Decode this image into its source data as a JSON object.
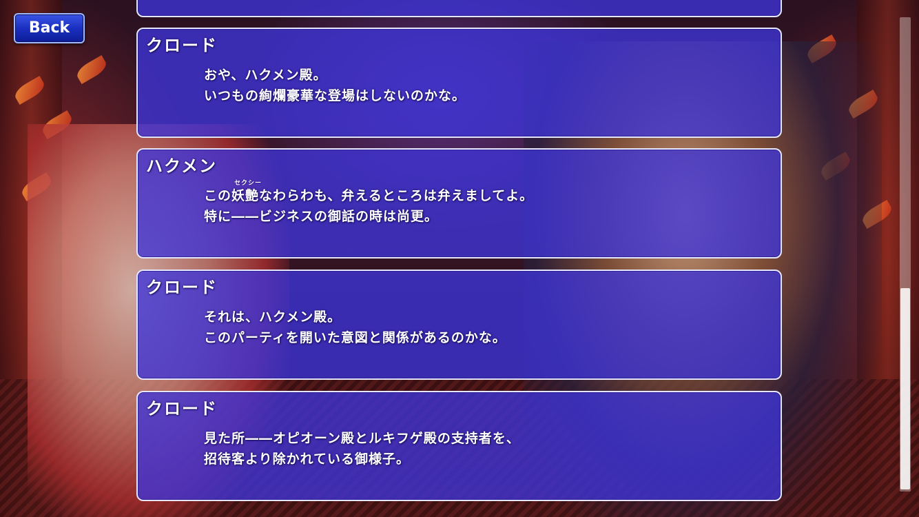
{
  "back_button": {
    "label": "Back"
  },
  "colors": {
    "panel_fill": "#3e34da",
    "panel_border": "#e6e6ff",
    "back_button": "#1a2fc0",
    "text": "#ffffff"
  },
  "scrollbar": {
    "position_fraction": 0.57,
    "visible_fraction": 0.42
  },
  "log": [
    {
      "speaker": "クロード",
      "lines": [
        "おや、ハクメン殿。",
        "いつもの絢爛豪華な登場はしないのかな。"
      ]
    },
    {
      "speaker": "ハクメン",
      "ruby": "セクシー",
      "lines": [
        "この妖艶なわらわも、弁えるところは弁えましてよ。",
        "特に――ビジネスの御話の時は尚更。"
      ]
    },
    {
      "speaker": "クロード",
      "lines": [
        "それは、ハクメン殿。",
        "このパーティを開いた意図と関係があるのかな。"
      ]
    },
    {
      "speaker": "クロード",
      "lines": [
        "見た所――オピオーン殿とルキフゲ殿の支持者を、",
        "招待客より除かれている御様子。"
      ]
    }
  ]
}
